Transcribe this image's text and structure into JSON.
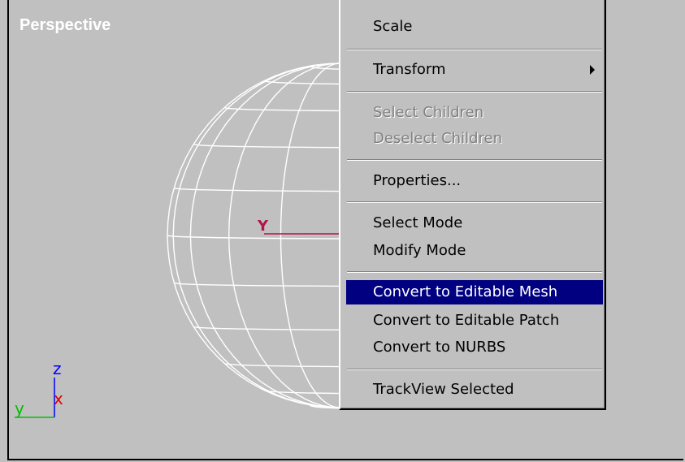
{
  "viewport": {
    "label": "Perspective",
    "gizmo_axis_label": "Y",
    "axis_tripod": {
      "x": "x",
      "y": "y",
      "z": "z"
    }
  },
  "context_menu": {
    "items": [
      {
        "label": "Scale",
        "enabled": true
      },
      {
        "label": "Transform",
        "enabled": true,
        "submenu": true
      },
      {
        "label": "Select Children",
        "enabled": false
      },
      {
        "label": "Deselect Children",
        "enabled": false
      },
      {
        "label": "Properties...",
        "enabled": true
      },
      {
        "label": "Select Mode",
        "enabled": true
      },
      {
        "label": "Modify Mode",
        "enabled": true
      },
      {
        "label": "Convert to Editable Mesh",
        "enabled": true,
        "highlighted": true
      },
      {
        "label": "Convert to Editable Patch",
        "enabled": true
      },
      {
        "label": "Convert to NURBS",
        "enabled": true
      },
      {
        "label": "TrackView Selected",
        "enabled": true
      }
    ]
  },
  "colors": {
    "viewport_bg": "#c0c0c0",
    "wireframe": "#ffffff",
    "highlight_bg": "#000080",
    "gizmo": "#b0144a",
    "axis_x": "#e00000",
    "axis_y": "#00c000",
    "axis_z": "#0000ff"
  }
}
